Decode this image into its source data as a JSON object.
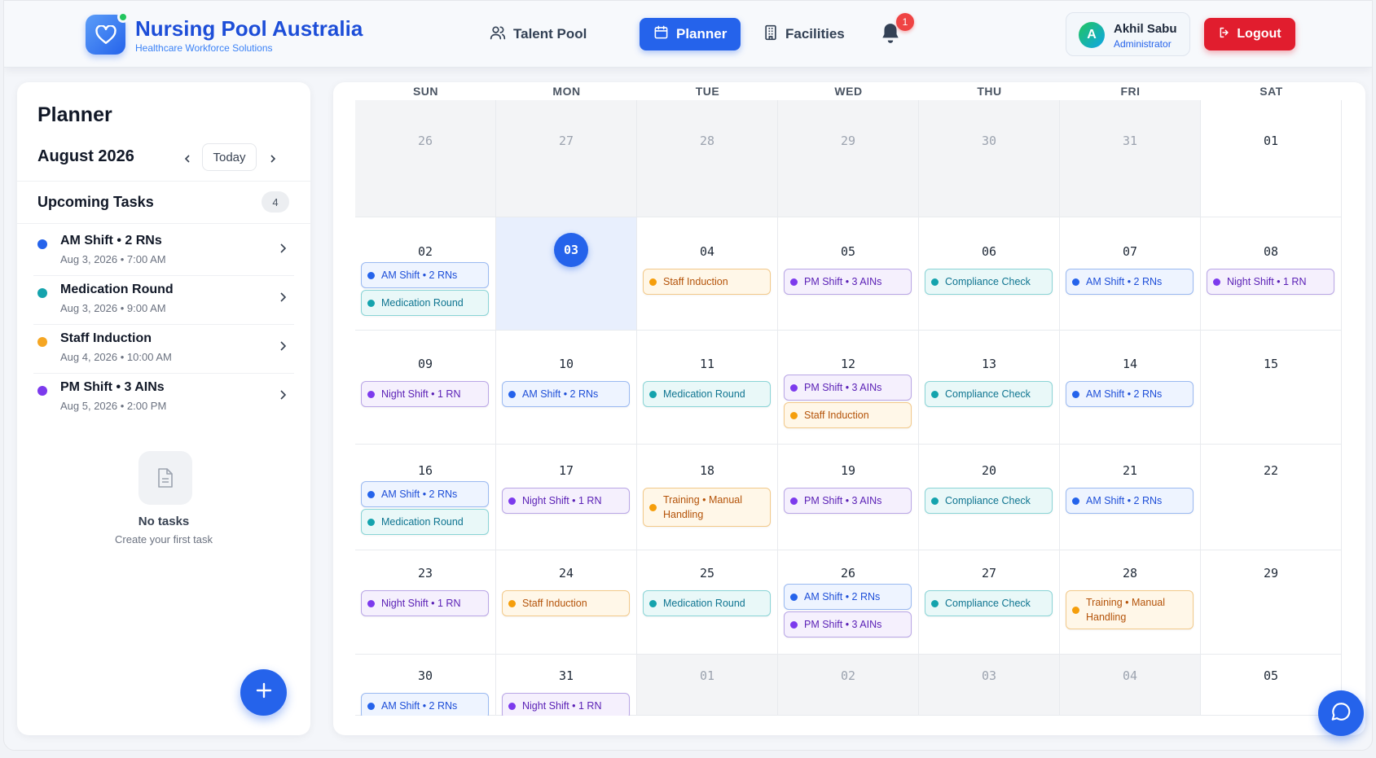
{
  "app": {
    "title": "Nursing Pool Australia",
    "subtitle": "Healthcare Workforce Solutions"
  },
  "nav": {
    "items": [
      {
        "label": "Talent Pool",
        "icon": "users-icon",
        "active": false
      },
      {
        "label": "Planner",
        "icon": "calendar-icon",
        "active": true
      },
      {
        "label": "Facilities",
        "icon": "building-icon",
        "active": false
      }
    ],
    "notifications": "1"
  },
  "user": {
    "initial": "A",
    "name": "Akhil Sabu",
    "role": "Administrator"
  },
  "logout_label": "Logout",
  "sidebar": {
    "title": "Planner",
    "month": "August 2026",
    "today_label": "Today",
    "upcoming_title": "Upcoming Tasks",
    "upcoming_count": "4",
    "tasks": [
      {
        "name": "AM Shift • 2 RNs",
        "date": "Aug 3, 2026 • 7:00 AM",
        "color": "#2563eb"
      },
      {
        "name": "Medication Round",
        "date": "Aug 3, 2026 • 9:00 AM",
        "color": "#14a3ad"
      },
      {
        "name": "Staff Induction",
        "date": "Aug 4, 2026 • 10:00 AM",
        "color": "#f5a623"
      },
      {
        "name": "PM Shift • 3 AINs",
        "date": "Aug 5, 2026 • 2:00 PM",
        "color": "#7c3aed"
      }
    ],
    "empty_title": "No tasks",
    "empty_subtitle": "Create your first task"
  },
  "calendar": {
    "days": [
      "SUN",
      "MON",
      "TUE",
      "WED",
      "THU",
      "FRI",
      "SAT"
    ],
    "weeks": [
      [
        {
          "day": "26",
          "muted": true,
          "events": []
        },
        {
          "day": "27",
          "muted": true,
          "events": []
        },
        {
          "day": "28",
          "muted": true,
          "events": []
        },
        {
          "day": "29",
          "muted": true,
          "events": []
        },
        {
          "day": "30",
          "muted": true,
          "events": []
        },
        {
          "day": "31",
          "muted": true,
          "events": []
        },
        {
          "day": "01",
          "muted": false,
          "events": []
        }
      ],
      [
        {
          "day": "02",
          "events": [
            {
              "label": "AM Shift • 2 RNs",
              "type": "blue"
            },
            {
              "label": "Medication Round",
              "type": "teal"
            }
          ]
        },
        {
          "day": "03",
          "today": true,
          "events": []
        },
        {
          "day": "04",
          "events": [
            {
              "label": "Staff Induction",
              "type": "orange"
            }
          ]
        },
        {
          "day": "05",
          "events": [
            {
              "label": "PM Shift • 3 AINs",
              "type": "purple"
            }
          ]
        },
        {
          "day": "06",
          "events": [
            {
              "label": "Compliance Check",
              "type": "teal"
            }
          ]
        },
        {
          "day": "07",
          "events": [
            {
              "label": "AM Shift • 2 RNs",
              "type": "blue"
            }
          ]
        },
        {
          "day": "08",
          "events": [
            {
              "label": "Night Shift • 1 RN",
              "type": "purple"
            }
          ]
        }
      ],
      [
        {
          "day": "09",
          "events": [
            {
              "label": "Night Shift • 1 RN",
              "type": "purple"
            }
          ]
        },
        {
          "day": "10",
          "events": [
            {
              "label": "AM Shift • 2 RNs",
              "type": "blue"
            }
          ]
        },
        {
          "day": "11",
          "events": [
            {
              "label": "Medication Round",
              "type": "teal"
            }
          ]
        },
        {
          "day": "12",
          "events": [
            {
              "label": "PM Shift • 3 AINs",
              "type": "purple"
            },
            {
              "label": "Staff Induction",
              "type": "orange"
            }
          ]
        },
        {
          "day": "13",
          "events": [
            {
              "label": "Compliance Check",
              "type": "teal"
            }
          ]
        },
        {
          "day": "14",
          "events": [
            {
              "label": "AM Shift • 2 RNs",
              "type": "blue"
            }
          ]
        },
        {
          "day": "15",
          "events": []
        }
      ],
      [
        {
          "day": "16",
          "events": [
            {
              "label": "AM Shift • 2 RNs",
              "type": "blue"
            },
            {
              "label": "Medication Round",
              "type": "teal"
            }
          ]
        },
        {
          "day": "17",
          "events": [
            {
              "label": "Night Shift • 1 RN",
              "type": "purple"
            }
          ]
        },
        {
          "day": "18",
          "events": [
            {
              "label": "Training • Manual Handling",
              "type": "orange"
            }
          ]
        },
        {
          "day": "19",
          "events": [
            {
              "label": "PM Shift • 3 AINs",
              "type": "purple"
            }
          ]
        },
        {
          "day": "20",
          "events": [
            {
              "label": "Compliance Check",
              "type": "teal"
            }
          ]
        },
        {
          "day": "21",
          "events": [
            {
              "label": "AM Shift • 2 RNs",
              "type": "blue"
            }
          ]
        },
        {
          "day": "22",
          "events": []
        }
      ],
      [
        {
          "day": "23",
          "events": [
            {
              "label": "Night Shift • 1 RN",
              "type": "purple"
            }
          ]
        },
        {
          "day": "24",
          "events": [
            {
              "label": "Staff Induction",
              "type": "orange"
            }
          ]
        },
        {
          "day": "25",
          "events": [
            {
              "label": "Medication Round",
              "type": "teal"
            }
          ]
        },
        {
          "day": "26",
          "events": [
            {
              "label": "AM Shift • 2 RNs",
              "type": "blue"
            },
            {
              "label": "PM Shift • 3 AINs",
              "type": "purple"
            }
          ]
        },
        {
          "day": "27",
          "events": [
            {
              "label": "Compliance Check",
              "type": "teal"
            }
          ]
        },
        {
          "day": "28",
          "events": [
            {
              "label": "Training • Manual Handling",
              "type": "orange"
            }
          ]
        },
        {
          "day": "29",
          "events": []
        }
      ],
      [
        {
          "day": "30",
          "events": [
            {
              "label": "AM Shift • 2 RNs",
              "type": "blue"
            }
          ]
        },
        {
          "day": "31",
          "events": [
            {
              "label": "Night Shift • 1 RN",
              "type": "purple"
            }
          ]
        },
        {
          "day": "01",
          "muted": true,
          "events": []
        },
        {
          "day": "02",
          "muted": true,
          "events": []
        },
        {
          "day": "03",
          "muted": true,
          "events": []
        },
        {
          "day": "04",
          "muted": true,
          "events": []
        },
        {
          "day": "05",
          "muted": false,
          "events": []
        }
      ]
    ]
  },
  "colors": {
    "brand": "#1d4ed8",
    "primary": "#2563eb",
    "danger": "#e11d2e",
    "blue": "#2563eb",
    "teal": "#14a3ad",
    "purple": "#7c3aed",
    "orange": "#f59e0b"
  }
}
